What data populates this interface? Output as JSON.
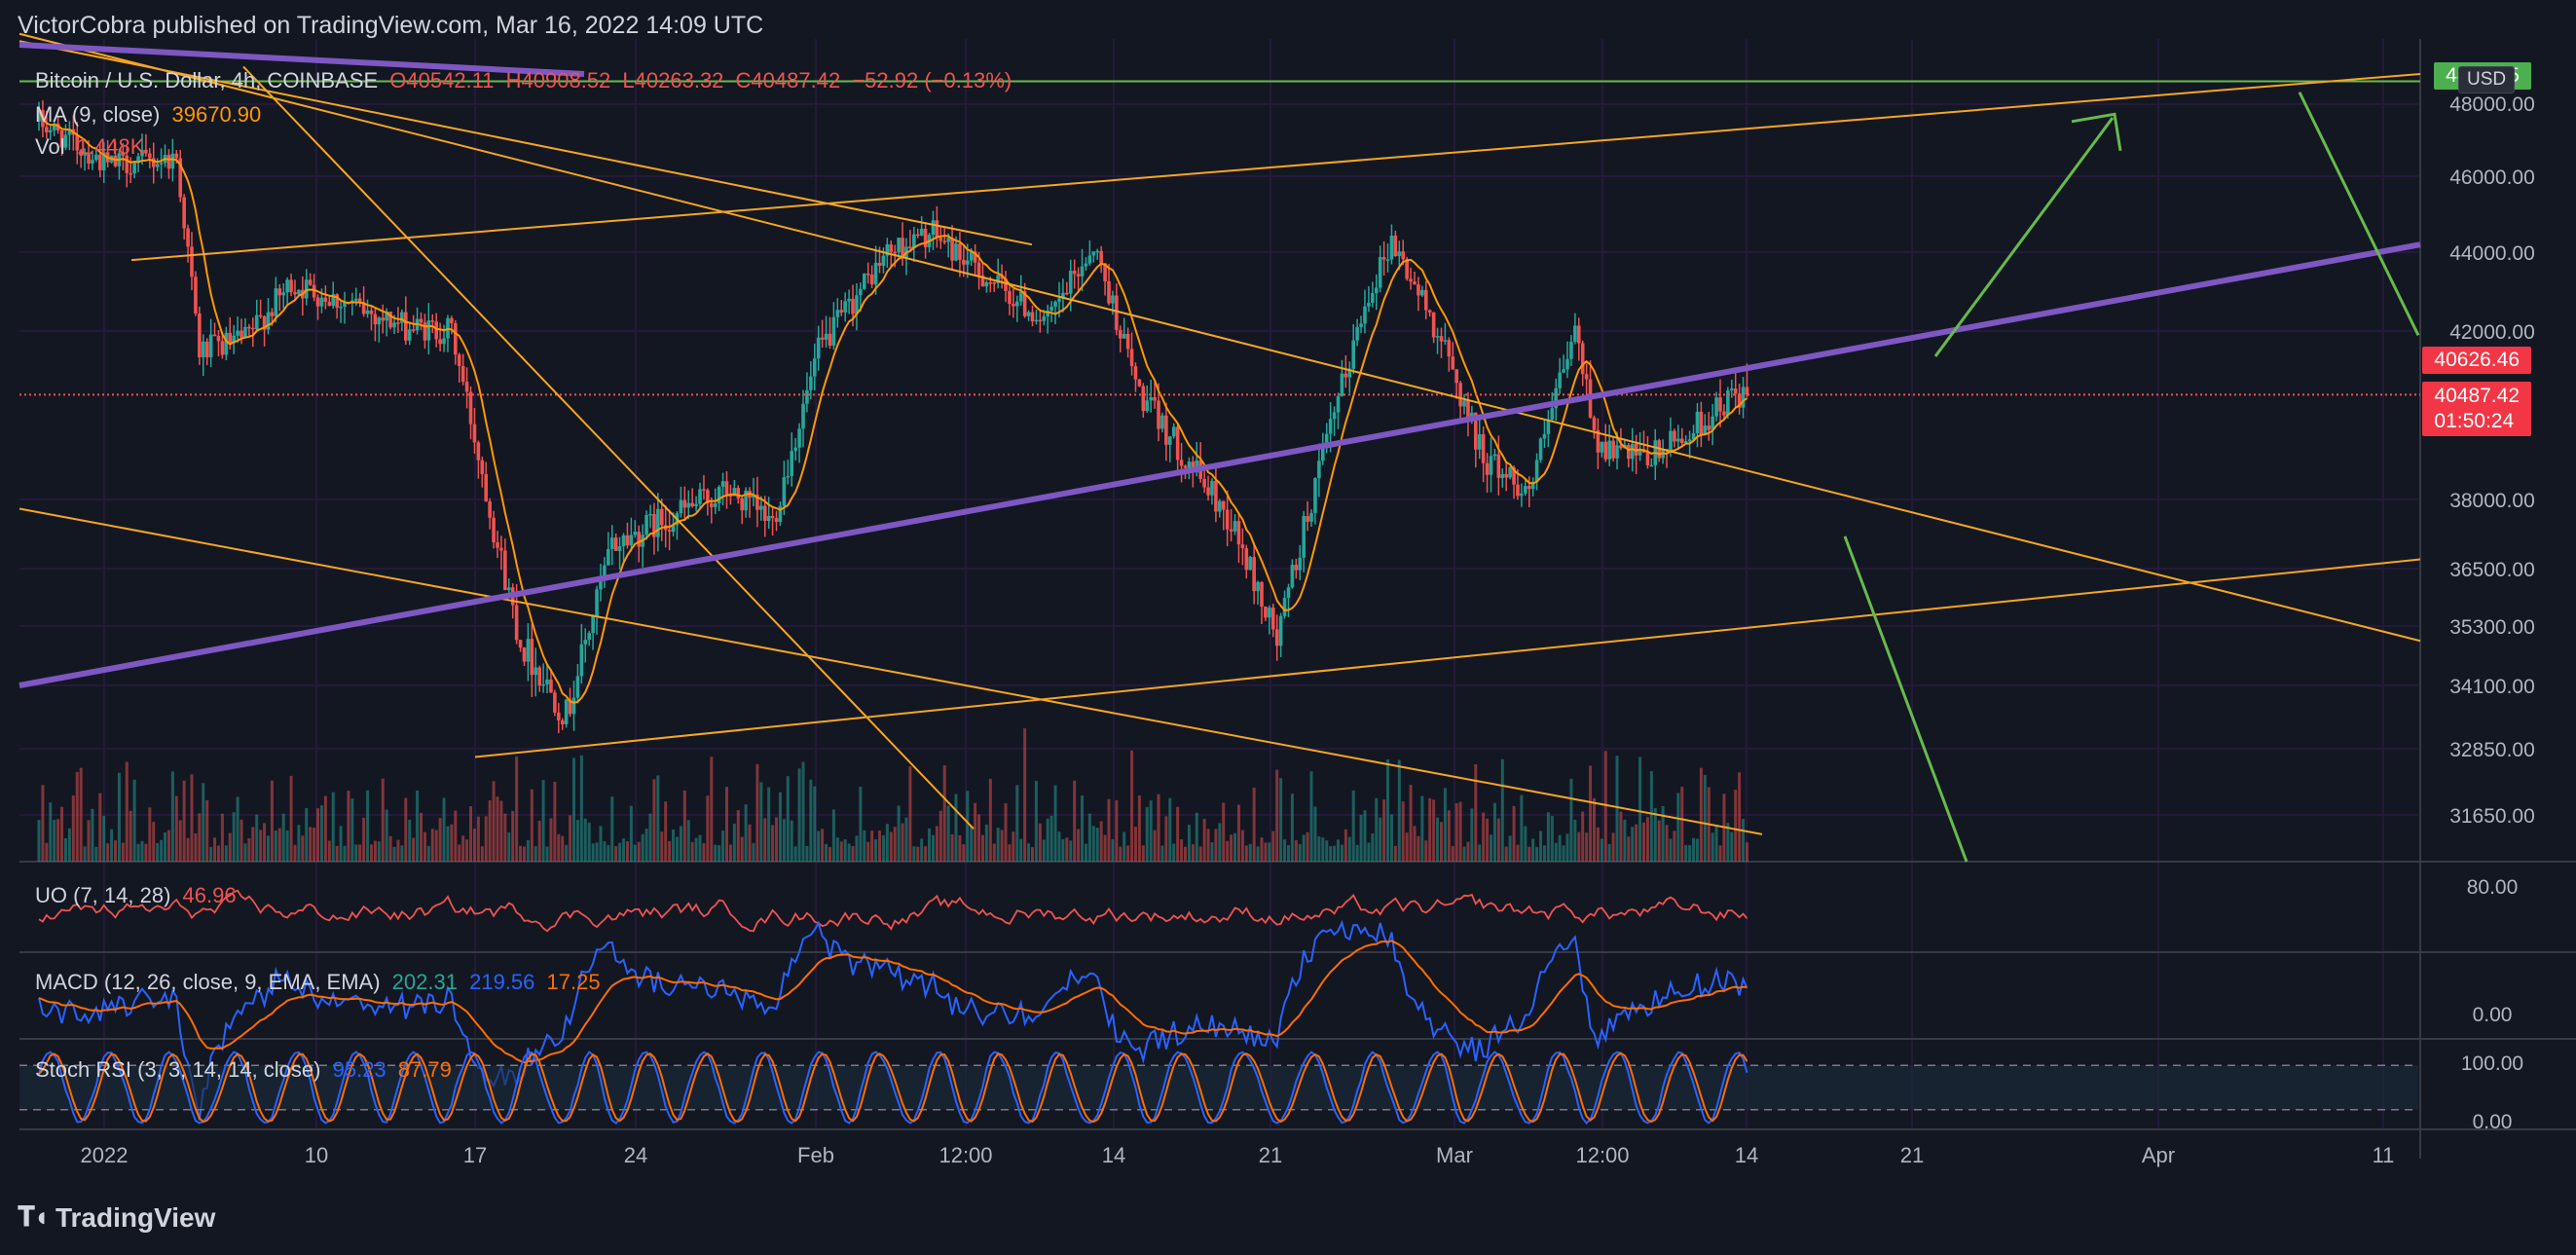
{
  "header": {
    "publisher_line": "VictorCobra published on TradingView.com, Mar 16, 2022 14:09 UTC"
  },
  "brand": {
    "logo_text": "TradingView"
  },
  "legend": {
    "symbol": "Bitcoin / U.S. Dollar, 4h, COINBASE",
    "open": "O40542.11",
    "high": "H40908.52",
    "low": "L40263.32",
    "close": "C40487.42",
    "change": "−52.92 (−0.13%)",
    "ma_label": "MA (9, close)",
    "ma_value": "39670.90",
    "vol_label": "Vol",
    "vol_value": "1.448K"
  },
  "currency_button": "USD",
  "price_tags": {
    "top": "48       5",
    "upper": "40626.46",
    "last": "40487.42",
    "countdown": "01:50:24"
  },
  "indicators": {
    "uo": {
      "label": "UO (7, 14, 28)",
      "value": "46.96"
    },
    "macd": {
      "label": "MACD (12, 26, close, 9, EMA, EMA)",
      "v1": "202.31",
      "v2": "219.56",
      "v3": "17.25"
    },
    "stoch": {
      "label": "Stoch RSI (3, 3, 14, 14, close)",
      "k": "95.23",
      "d": "87.79"
    }
  },
  "colors": {
    "background": "#131722",
    "grid": "#241a3a",
    "up": "#26a69a",
    "down": "#ef5350",
    "ma": "#ff9800",
    "trend_orange": "#f5a623",
    "trend_purple": "#7e57c2",
    "arrow_green": "#66bb4a",
    "macd_blue": "#2962ff",
    "stoch_orange": "#ff6d00"
  },
  "chart_data": {
    "type": "candlestick",
    "title": "Bitcoin / U.S. Dollar, 4h, COINBASE",
    "y_axis_ticks": [
      "48000.00",
      "46000.00",
      "44000.00",
      "42000.00",
      "38000.00",
      "36500.00",
      "35300.00",
      "34100.00",
      "32850.00",
      "31650.00"
    ],
    "y_axis_type": "log",
    "ylim": [
      30500,
      49800
    ],
    "x_axis_ticks": [
      "2022",
      "10",
      "17",
      "24",
      "Feb",
      "12:00",
      "14",
      "21",
      "Mar",
      "12:00",
      "14",
      "21",
      "Apr",
      "11"
    ],
    "grid": true,
    "last_price": 40487.42,
    "close_path_anchors": [
      [
        "Jan 1",
        47500
      ],
      [
        "Jan 4",
        46300
      ],
      [
        "Jan 7",
        46500
      ],
      [
        "Jan 8",
        41500
      ],
      [
        "Jan 10",
        41800
      ],
      [
        "Jan 12",
        43200
      ],
      [
        "Jan 14",
        42800
      ],
      [
        "Jan 17",
        42100
      ],
      [
        "Jan 19",
        42000
      ],
      [
        "Jan 21",
        37000
      ],
      [
        "Jan 22",
        35000
      ],
      [
        "Jan 24",
        33500
      ],
      [
        "Jan 26",
        37000
      ],
      [
        "Jan 28",
        37500
      ],
      [
        "Jan 31",
        38200
      ],
      [
        "Feb 2",
        37500
      ],
      [
        "Feb 4",
        41500
      ],
      [
        "Feb 7",
        44000
      ],
      [
        "Feb 9",
        44500
      ],
      [
        "Feb 11",
        43500
      ],
      [
        "Feb 14",
        42200
      ],
      [
        "Feb 16",
        44200
      ],
      [
        "Feb 18",
        40500
      ],
      [
        "Feb 20",
        39000
      ],
      [
        "Feb 22",
        37500
      ],
      [
        "Feb 24",
        35000
      ],
      [
        "Feb 26",
        39000
      ],
      [
        "Feb 28",
        43000
      ],
      [
        "Mar 1",
        44300
      ],
      [
        "Mar 3",
        42000
      ],
      [
        "Mar 5",
        39000
      ],
      [
        "Mar 7",
        38200
      ],
      [
        "Mar 9",
        42000
      ],
      [
        "Mar 10",
        39300
      ],
      [
        "Mar 12",
        38900
      ],
      [
        "Mar 14",
        39600
      ],
      [
        "Mar 16",
        40487
      ]
    ],
    "horizontal_levels": [
      {
        "price": 48600,
        "color": "green"
      },
      {
        "price": 40487.42,
        "color": "red",
        "style": "dotted"
      }
    ],
    "indicator_ranges": {
      "uo": [
        0,
        100
      ],
      "stoch_rsi": [
        0,
        100
      ],
      "stoch_bands": [
        20,
        80
      ]
    }
  }
}
